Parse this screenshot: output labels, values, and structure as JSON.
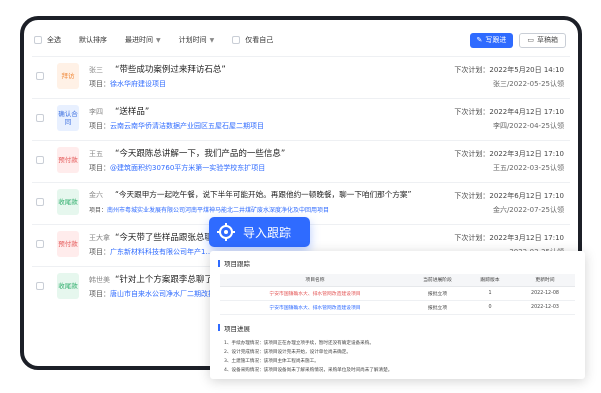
{
  "toolbar": {
    "select_all": "全选",
    "default_sort": "默认排序",
    "latest_time": "最进时间",
    "plan_time": "计划时间",
    "mine_only": "仅看自己",
    "follow_btn": "写跟进",
    "draft_btn": "草稿箱",
    "follow_icon": "edit-icon",
    "draft_icon": "drafts-icon"
  },
  "rows": [
    {
      "badge": "拜访",
      "badge_color": "#f08a3c",
      "who": "张三",
      "quote": "“带些成功案例过来拜访石总”",
      "project_prefix": "项目：",
      "project": "徐水华府建设项目",
      "plan": "下次计划：2022年5月20日 14:10",
      "ack": "张三/2022-05-25认领"
    },
    {
      "badge": "确认合同",
      "badge_color": "#3b6fe0",
      "who": "李四",
      "quote": "“送样品”",
      "project_prefix": "项目：",
      "project": "云南云南华侨清洁数据产业园区五屋石屋二期项目",
      "plan": "下次计划：2022年4月12日 17:10",
      "ack": "李四/2022-04-25认领"
    },
    {
      "badge": "预付款",
      "badge_color": "#e45757",
      "who": "王五",
      "quote": "“今天跟陈总讲解一下，我们产品的一些信息”",
      "project_prefix": "项目：",
      "project": "@建筑面积约30760平方米第一实验学校东扩项目",
      "plan": "下次计划：2022年3月12日 17:10",
      "ack": "王五/2022-03-25认领"
    },
    {
      "badge": "收尾款",
      "badge_color": "#2fae6c",
      "who": "金六",
      "quote": "“今天跟甲方一起吃午餐，说下半年可能开始。再跟他约一顿晚餐，聊一下咱们那个方案”",
      "project_prefix": "项目：",
      "project": "南州市粤城实业发展有限公司河南平煤神马能北二井煤矿废水深度净化及中回用项目",
      "plan": "下次计划：2022年6月12日 17:10",
      "ack": "金六/2022-07-25认领"
    },
    {
      "badge": "预付款",
      "badge_color": "#e45757",
      "who": "王大拿",
      "quote": "“今天带了些样品跟张总聊了…”",
      "project_prefix": "项目：",
      "project": "广东新材料科技有限公司年产1…",
      "plan": "下次计划：2022年3月12日 17:10",
      "ack": "…2022-03-25认领"
    },
    {
      "badge": "收尾款",
      "badge_color": "#2fae6c",
      "who": "韩世美",
      "quote": "“针对上个方案跟李总聊了…”",
      "project_prefix": "项目：",
      "project": "唐山市自来水公司净水厂二期改扩…",
      "plan": "",
      "ack": ""
    }
  ],
  "import_tag": {
    "label": "导入跟踪",
    "icon": "crosshair-icon"
  },
  "panel": {
    "section1": "项目跟踪",
    "headers": [
      "项目名称",
      "当前进展阶段",
      "跟踪版本",
      "更新时间"
    ],
    "rows": [
      {
        "name": "宁安市国镇确水大、排水管网改造建设项目",
        "stage": "报批立项",
        "version": "1",
        "updated": "2022-12-08",
        "highlight": true
      },
      {
        "name": "宁安市国镇确水大、排水管网改造建设项目",
        "stage": "报批立项",
        "version": "0",
        "updated": "2022-12-03",
        "highlight": false
      }
    ],
    "section2": "项目进展",
    "progress": [
      "1、手续办理情况：该项目正在办理立项手续，暂时还没有确定设备采购。",
      "2、设计完成情况：该项目设计完未开始，设计单位尚未确定。",
      "3、土建施工情况：该项目主体工程尚未施工。",
      "4、设备采购情况：该项目设备尚未了解采购情况，采购单位及时间尚未了解清楚。"
    ]
  }
}
